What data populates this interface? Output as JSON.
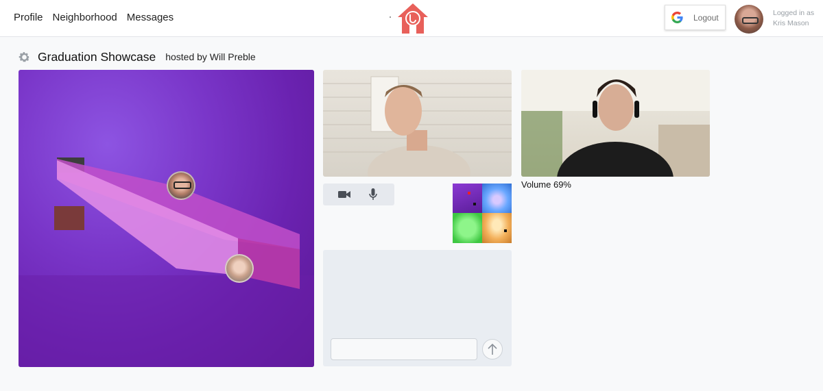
{
  "nav": {
    "profile": "Profile",
    "neighborhood": "Neighborhood",
    "messages": "Messages"
  },
  "header": {
    "logout_label": "Logout",
    "logged_in_as": "Logged in as",
    "user_name": "Kris Mason"
  },
  "room": {
    "title": "Graduation Showcase",
    "host": "hosted by Will Preble"
  },
  "video2": {
    "volume_label": "Volume 69%",
    "volume_percent": 69
  },
  "chat": {
    "input_value": "",
    "input_placeholder": ""
  },
  "colors": {
    "brand": "#e8605a",
    "scene_purple": "#7a36c9",
    "panel": "#e9edf2"
  },
  "icons": {
    "logo": "house-logo-icon",
    "google": "google-g-icon",
    "settings": "gear-icon",
    "camera": "video-camera-icon",
    "mic": "microphone-icon",
    "send": "arrow-up-icon"
  }
}
